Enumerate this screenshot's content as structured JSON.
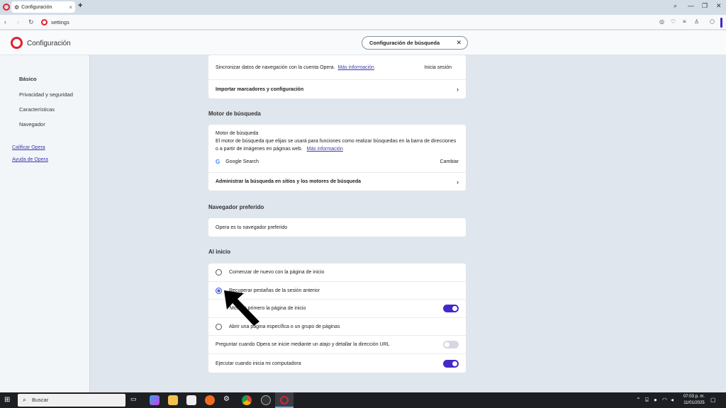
{
  "browser": {
    "tab_title": "Configuración",
    "url": "settings"
  },
  "page": {
    "title": "Configuración",
    "search_value": "Configuración de búsqueda"
  },
  "sidebar": {
    "items": [
      "Básico",
      "Privacidad y seguridad",
      "Características",
      "Navegador"
    ],
    "links": [
      "Calificar Opera",
      "Ayuda de Opera"
    ]
  },
  "sync": {
    "text": "Sincronizar datos de navegación con la cuenta Opera.",
    "link": "Más información",
    "action": "Inicia sesión",
    "import_label": "Importar marcadores y configuración"
  },
  "search_engine": {
    "section": "Motor de búsqueda",
    "heading": "Motor de búsqueda",
    "desc": "El motor de búsqueda que elijas se usará para funciones como realizar búsquedas en la barra de direcciones o a partir de imágenes en páginas web.",
    "link": "Más información",
    "engine": "Google Search",
    "change": "Cambiar",
    "manage": "Administrar la búsqueda en sitios y los motores de búsqueda"
  },
  "default_browser": {
    "section": "Navegador preferido",
    "text": "Opera es tu navegador preferido"
  },
  "startup": {
    "section": "Al inicio",
    "options": [
      {
        "label": "Comenzar de nuevo con la página de inicio",
        "selected": false
      },
      {
        "label": "Recuperar pestañas de la sesión anterior",
        "selected": true
      },
      {
        "label": "Mostrar primero la página de inicio",
        "toggle": true
      },
      {
        "label": "Abrir una página específica o un grupo de páginas",
        "selected": false
      }
    ],
    "ask_label": "Preguntar cuando Opera se inicie mediante un atajo y detallar la dirección URL",
    "ask_toggle": false,
    "run_label": "Ejecutar cuando inicia mi computadora",
    "run_toggle": true
  },
  "taskbar": {
    "search": "Buscar",
    "time": "07:03 p. m.",
    "date": "11/01/2025"
  },
  "colors": {
    "accent": "#4628c8",
    "opera_red": "#e0202e",
    "link": "#3b3ba8"
  }
}
